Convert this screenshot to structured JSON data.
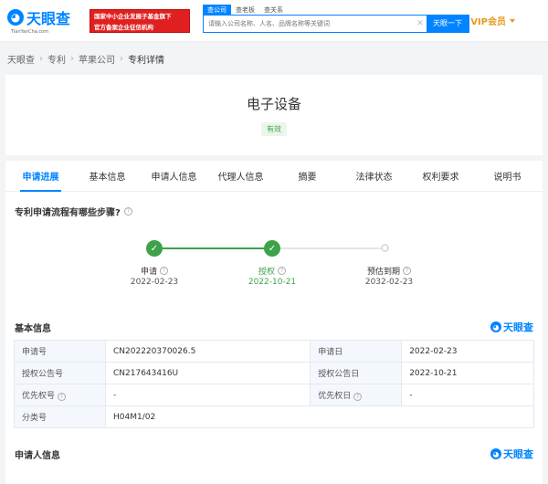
{
  "header": {
    "logo_text": "天眼查",
    "logo_sub": "TianYanCha.com",
    "banner_line1": "国家中小企业发展子基金旗下",
    "banner_line2": "官方备案企业征信机构",
    "search_tabs": [
      "查公司",
      "查老板",
      "查关系"
    ],
    "search_placeholder": "请输入公司名称、人名、品牌名称等关键词",
    "search_button": "天眼一下",
    "vip": "VIP会员"
  },
  "breadcrumb": [
    "天眼查",
    "专利",
    "苹果公司",
    "专利详情"
  ],
  "patent": {
    "title": "电子设备",
    "status": "有效"
  },
  "tabs": [
    "申请进展",
    "基本信息",
    "申请人信息",
    "代理人信息",
    "摘要",
    "法律状态",
    "权利要求",
    "说明书"
  ],
  "process": {
    "title": "专利申请流程有哪些步骤?",
    "steps": [
      {
        "label": "申请",
        "date": "2022-02-23",
        "done": true
      },
      {
        "label": "授权",
        "date": "2022-10-21",
        "done": true
      },
      {
        "label": "预估到期",
        "date": "2032-02-23",
        "done": false
      }
    ]
  },
  "basic_info": {
    "title": "基本信息",
    "brand": "天眼查",
    "rows": [
      {
        "k1": "申请号",
        "v1": "CN202220370026.5",
        "k2": "申请日",
        "v2": "2022-02-23"
      },
      {
        "k1": "授权公告号",
        "v1": "CN217643416U",
        "k2": "授权公告日",
        "v2": "2022-10-21"
      },
      {
        "k1": "优先权号",
        "v1": "-",
        "k2": "优先权日",
        "v2": "-"
      },
      {
        "k1": "分类号",
        "v1": "H04M1/02"
      }
    ]
  },
  "applicant_info": {
    "title": "申请人信息",
    "brand": "天眼查"
  },
  "colors": {
    "brand_blue": "#0084ff",
    "progress_green": "#3da24a",
    "vip_orange": "#e69a1a"
  }
}
